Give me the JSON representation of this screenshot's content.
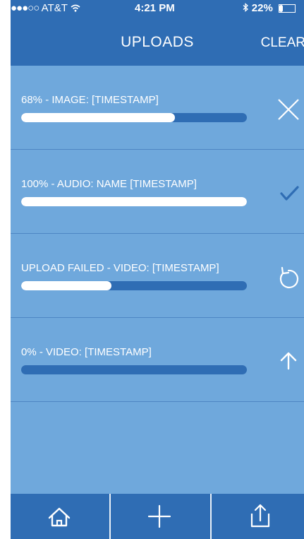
{
  "status_bar": {
    "carrier": "AT&T",
    "signal_dots": "●●●○○",
    "time": "4:21 PM",
    "bluetooth_icon": "bluetooth-icon",
    "battery_percent_text": "22%",
    "battery_level": 0.22
  },
  "header": {
    "title": "UPLOADS",
    "clear_label": "CLEAR"
  },
  "uploads": [
    {
      "label": "68% - IMAGE: [TIMESTAMP]",
      "progress": 0.68,
      "action_icon": "close-icon"
    },
    {
      "label": "100% - AUDIO: NAME [TIMESTAMP]",
      "progress": 1.0,
      "action_icon": "checkmark-icon"
    },
    {
      "label": "UPLOAD FAILED - VIDEO: [TIMESTAMP]",
      "progress": 0.4,
      "action_icon": "retry-icon"
    },
    {
      "label": "0% - VIDEO: [TIMESTAMP]",
      "progress": 0.0,
      "action_icon": "upload-arrow-icon"
    }
  ],
  "tabbar": {
    "items": [
      {
        "icon": "home-icon"
      },
      {
        "icon": "plus-icon"
      },
      {
        "icon": "share-icon"
      }
    ]
  },
  "colors": {
    "header": "#2f6db4",
    "background": "#6fa8dc",
    "track": "#2f6db4",
    "fill": "#ffffff"
  }
}
